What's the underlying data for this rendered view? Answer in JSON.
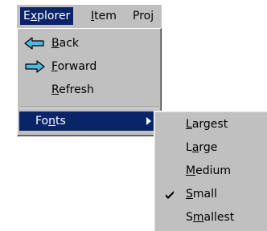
{
  "menubar": {
    "items": [
      {
        "label": "Explorer",
        "accel": "x",
        "active": true
      },
      {
        "label": "Item",
        "accel": "I"
      },
      {
        "label": "Proj",
        "accel": ""
      }
    ]
  },
  "menu": {
    "items": [
      {
        "label": "Back",
        "accel": "B",
        "icon": "back-arrow-icon"
      },
      {
        "label": "Forward",
        "accel": "F",
        "icon": "forward-arrow-icon"
      },
      {
        "label": "Refresh",
        "accel": "R"
      }
    ],
    "fonts": {
      "label": "Fonts",
      "accel": "n",
      "highlighted": true,
      "has_submenu": true
    }
  },
  "submenu": {
    "items": [
      {
        "label": "Largest",
        "accel": "L"
      },
      {
        "label": "Large",
        "accel": "a"
      },
      {
        "label": "Medium",
        "accel": "M"
      },
      {
        "label": "Small",
        "accel": "S",
        "checked": true
      },
      {
        "label": "Smallest",
        "accel": "m"
      }
    ]
  },
  "colors": {
    "menu_bg": "#c0c0c0",
    "highlight_bg": "#0a246a",
    "highlight_text": "#ffffff",
    "icon_arrow": "#4fb6e0"
  }
}
